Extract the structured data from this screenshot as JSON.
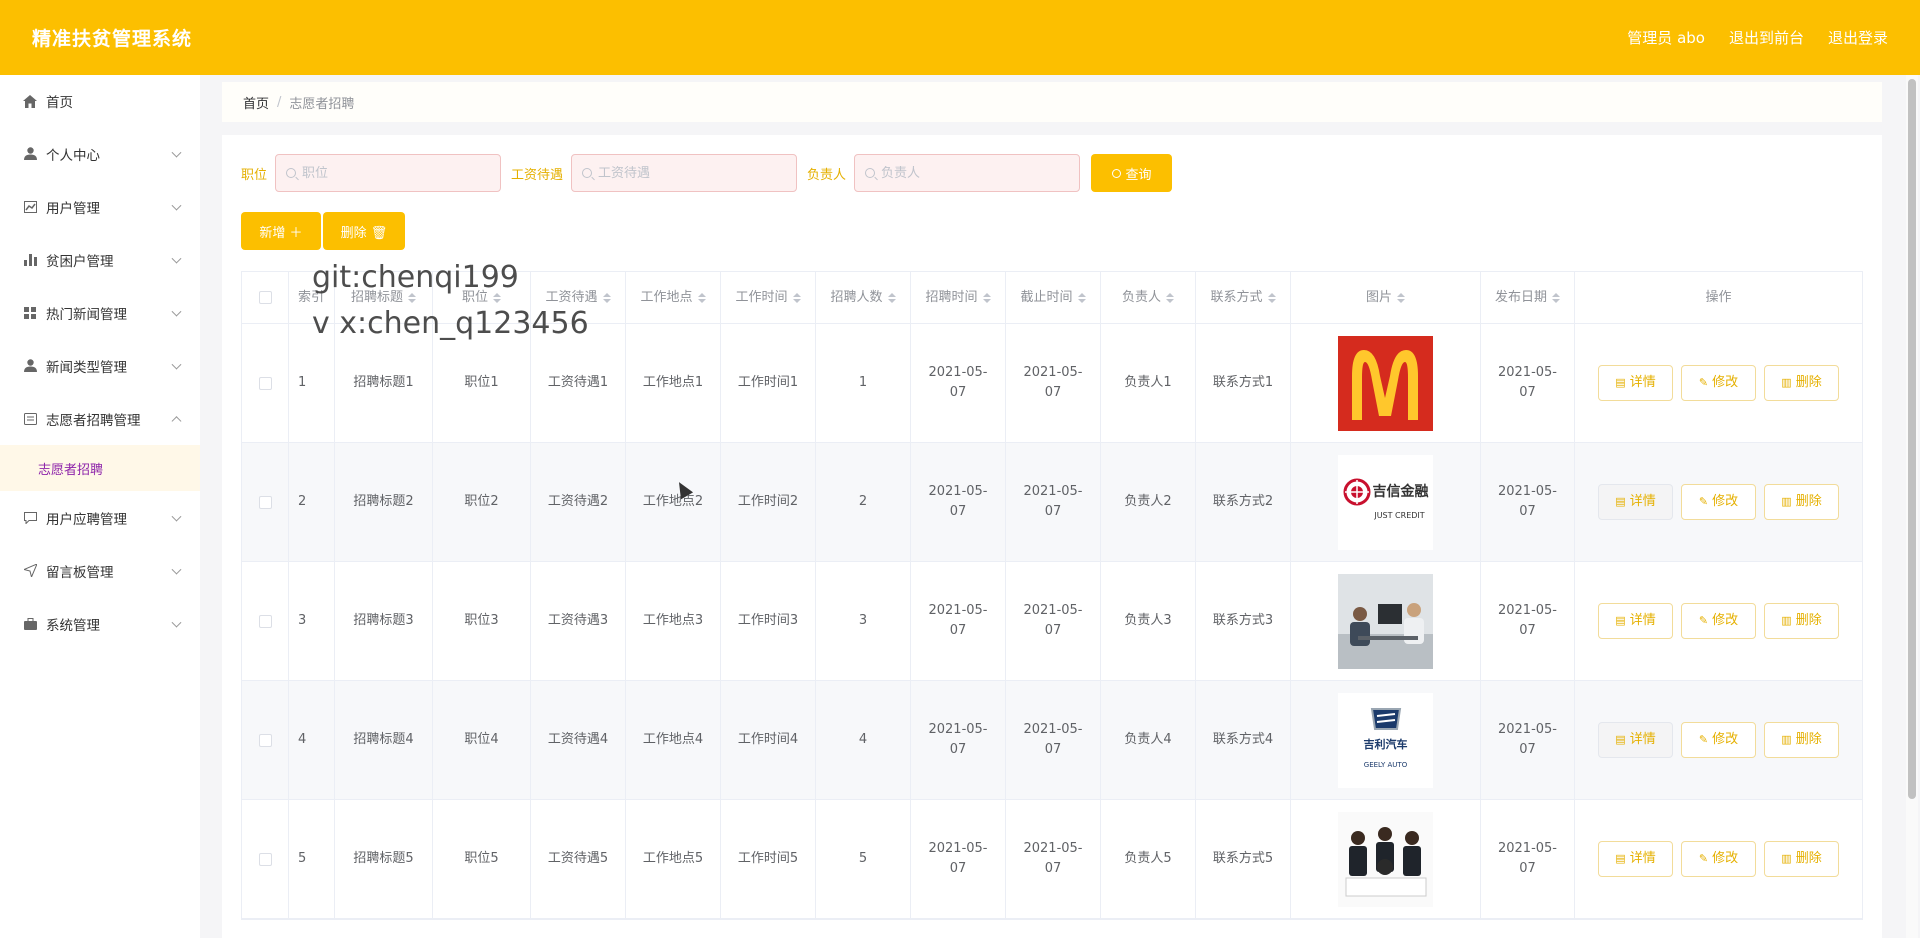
{
  "header": {
    "title": "精准扶贫管理系统",
    "admin": "管理员 abo",
    "front": "退出到前台",
    "logout": "退出登录"
  },
  "sidebar": {
    "items": [
      {
        "label": "首页",
        "icon": "home-icon"
      },
      {
        "label": "个人中心",
        "icon": "user-icon"
      },
      {
        "label": "用户管理",
        "icon": "chart-line-icon"
      },
      {
        "label": "贫困户管理",
        "icon": "bar-chart-icon"
      },
      {
        "label": "热门新闻管理",
        "icon": "grid-icon"
      },
      {
        "label": "新闻类型管理",
        "icon": "user-icon"
      },
      {
        "label": "志愿者招聘管理",
        "icon": "clipboard-icon"
      },
      {
        "label": "用户应聘管理",
        "icon": "chat-icon"
      },
      {
        "label": "留言板管理",
        "icon": "send-icon"
      },
      {
        "label": "系统管理",
        "icon": "briefcase-icon"
      }
    ],
    "sub_item": "志愿者招聘"
  },
  "breadcrumb": {
    "home": "首页",
    "sep": "/",
    "current": "志愿者招聘"
  },
  "search": {
    "f1_label": "职位",
    "f1_placeholder": "职位",
    "f2_label": "工资待遇",
    "f2_placeholder": "工资待遇",
    "f3_label": "负责人",
    "f3_placeholder": "负责人",
    "query": "查询"
  },
  "actions": {
    "add": "新增 ＋",
    "delete": "删除 🗑"
  },
  "table": {
    "headers": [
      "索引",
      "招聘标题",
      "职位",
      "工资待遇",
      "工作地点",
      "工作时间",
      "招聘人数",
      "招聘时间",
      "截止时间",
      "负责人",
      "联系方式",
      "图片",
      "发布日期",
      "操作"
    ],
    "rows": [
      {
        "idx": "1",
        "title": "招聘标题1",
        "pos": "职位1",
        "pay": "工资待遇1",
        "place": "工作地点1",
        "time": "工作时间1",
        "count": "1",
        "start": "2021-05-07",
        "end": "2021-05-07",
        "owner": "负责人1",
        "contact": "联系方式1",
        "pub": "2021-05-07",
        "img": "mcdonalds-logo"
      },
      {
        "idx": "2",
        "title": "招聘标题2",
        "pos": "职位2",
        "pay": "工资待遇2",
        "place": "工作地点2",
        "time": "工作时间2",
        "count": "2",
        "start": "2021-05-07",
        "end": "2021-05-07",
        "owner": "负责人2",
        "contact": "联系方式2",
        "pub": "2021-05-07",
        "img": "just-credit-logo"
      },
      {
        "idx": "3",
        "title": "招聘标题3",
        "pos": "职位3",
        "pay": "工资待遇3",
        "place": "工作地点3",
        "time": "工作时间3",
        "count": "3",
        "start": "2021-05-07",
        "end": "2021-05-07",
        "owner": "负责人3",
        "contact": "联系方式3",
        "pub": "2021-05-07",
        "img": "office-photo"
      },
      {
        "idx": "4",
        "title": "招聘标题4",
        "pos": "职位4",
        "pay": "工资待遇4",
        "place": "工作地点4",
        "time": "工作时间4",
        "count": "4",
        "start": "2021-05-07",
        "end": "2021-05-07",
        "owner": "负责人4",
        "contact": "联系方式4",
        "pub": "2021-05-07",
        "img": "geely-logo"
      },
      {
        "idx": "5",
        "title": "招聘标题5",
        "pos": "职位5",
        "pay": "工资待遇5",
        "place": "工作地点5",
        "time": "工作时间5",
        "count": "5",
        "start": "2021-05-07",
        "end": "2021-05-07",
        "owner": "负责人5",
        "contact": "联系方式5",
        "pub": "2021-05-07",
        "img": "team-photo"
      }
    ],
    "op_detail": "详情",
    "op_edit": "修改",
    "op_delete": "删除"
  },
  "logos": {
    "just_credit_cn": "吉信金融",
    "just_credit_en": "JUST CREDIT",
    "geely_cn": "吉利汽车",
    "geely_en": "GEELY AUTO"
  },
  "watermark": {
    "line1": "git:chenqi199",
    "line2": "v x:chen_q123456"
  },
  "colors": {
    "brand": "#fcbf00",
    "active_sub": "#8e24aa",
    "label": "#e5b000"
  }
}
